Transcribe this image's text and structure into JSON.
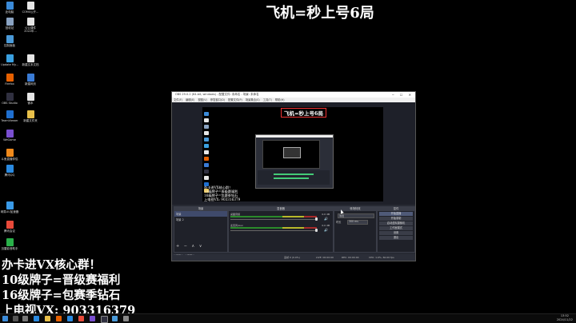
{
  "desktop": {
    "icons": [
      {
        "label": "此电脑",
        "color": "#3b8bd9"
      },
      {
        "label": "COMS公开...",
        "color": "#e6e6e6"
      },
      {
        "label": "回收站",
        "color": "#8aa3c2"
      },
      {
        "label": "公公课件 2022年...",
        "color": "#e6e6e6"
      },
      {
        "label": "控制面板",
        "color": "#4a9ad8"
      },
      {
        "label": "Update My...",
        "color": "#3aa0e0"
      },
      {
        "label": "新建文本文档",
        "color": "#e6e6e6"
      },
      {
        "label": "Firefox",
        "color": "#e66000"
      },
      {
        "label": "新建网页",
        "color": "#3a7bd5"
      },
      {
        "label": "OBS Studio",
        "color": "#303040"
      },
      {
        "label": "微本",
        "color": "#e6e6e6"
      },
      {
        "label": "TeamViewer",
        "color": "#1f6fd0"
      },
      {
        "label": "新建文件夹",
        "color": "#e8c04a"
      },
      {
        "label": "WeGame",
        "color": "#7a4fd0"
      },
      {
        "label": "斗鱼直播伴侣",
        "color": "#f08a1c"
      },
      {
        "label": "腾讯QQ",
        "color": "#2a8ae0"
      },
      {
        "label": "网易UU加速器",
        "color": "#3a9ae8"
      },
      {
        "label": "腾讯会议",
        "color": "#e84a3a"
      },
      {
        "label": "迅雷影音助手",
        "color": "#2ab04a"
      }
    ]
  },
  "overlay": {
    "title": "飞机=秒上号6局",
    "promo": [
      "办卡进VX核心群！",
      "10级牌子=晋级赛福利",
      "16级牌子=包赛季钻石",
      "上电视VX: 903316379"
    ]
  },
  "obs": {
    "window_title": "OBS 29.0.2 (64-bit, windows) - 配置文件: 未命名 - 场景: 未命名",
    "menu": [
      "文件(F)",
      "编辑(E)",
      "视图(V)",
      "停靠窗口(D)",
      "配置文件(P)",
      "场景集合(S)",
      "工具(T)",
      "帮助(H)"
    ],
    "preview_title": "飞机=秒上号6局",
    "preview_promo": [
      "办卡进VX核心群！",
      "10级牌子=晋级赛福利",
      "16级牌子=包赛季钻石",
      "上电视VX: 903316379"
    ],
    "docks": {
      "scenes": {
        "header": "场景",
        "items": [
          "场景",
          "场景 2"
        ],
        "tools": "+ − ∧ ∨"
      },
      "mixer": {
        "header": "混音器",
        "channels": [
          {
            "name": "桌面音频",
            "db": "0.0 dB"
          },
          {
            "name": "麦克风/Aux",
            "db": "0.0 dB"
          }
        ]
      },
      "transitions": {
        "header": "转场特效",
        "type": "淡出",
        "duration_label": "时长",
        "duration": "300 ms"
      },
      "controls": {
        "header": "控件",
        "buttons": [
          "开始直播",
          "开始录制",
          "启动虚拟摄像机",
          "工作室模式",
          "设置",
          "退出"
        ]
      }
    },
    "dock_tabs": [
      "场景",
      "来源"
    ],
    "status": {
      "dropped": "丢帧 0 (0.0%)",
      "live": "LIVE: 00:00:00",
      "rec": "REC: 00:00:00",
      "cpu": "CPU: 1.9%, 60.00 fps"
    }
  },
  "taskbar": {
    "time": "13:52",
    "date": "2024/11/22"
  }
}
